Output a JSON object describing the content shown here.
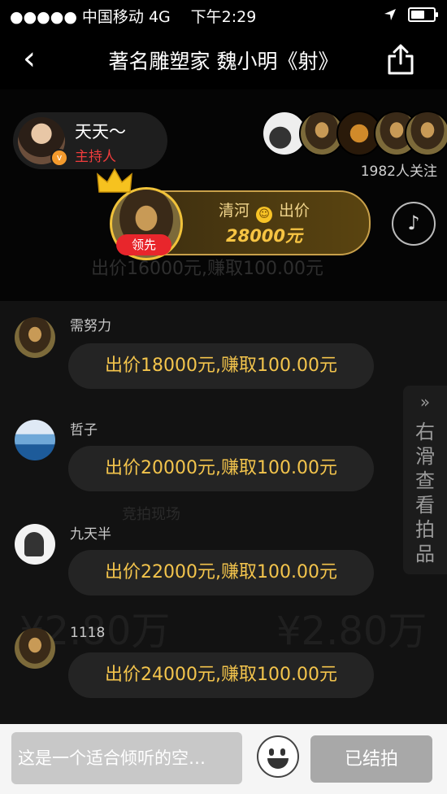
{
  "status_bar": {
    "carrier": "●●●●● 中国移动  4G",
    "time": "下午2:29"
  },
  "nav": {
    "back_glyph": "‹",
    "title": "著名雕塑家 魏小明《射》"
  },
  "host": {
    "name": "天天～",
    "role": "主持人",
    "badge": "v"
  },
  "followers": {
    "count_text": "1982人关注"
  },
  "top_bid": {
    "bidder": "清河",
    "emoji": "☺",
    "action": "出价",
    "amount": "28000元",
    "lead_tag": "领先"
  },
  "ghost_text": {
    "row": "出价16000元,赚取100.00元",
    "price_left": "¥2.80万",
    "price_right": "¥2.80万",
    "mid": "竞拍现场"
  },
  "messages": [
    {
      "name": "需努力",
      "text": "出价18000元,赚取100.00元"
    },
    {
      "name": "哲子",
      "text": "出价20000元,赚取100.00元"
    },
    {
      "name": "九天半",
      "text": "出价22000元,赚取100.00元"
    },
    {
      "name": "1118",
      "text": "出价24000元,赚取100.00元"
    }
  ],
  "side_tab": {
    "chevron": "»",
    "label": "右滑查看拍品"
  },
  "bottom": {
    "input_placeholder": "这是一个适合倾听的空…",
    "end_button": "已结拍"
  },
  "icons": [
    "back-icon",
    "share-icon",
    "location-icon",
    "battery-icon",
    "crown-icon",
    "music-icon",
    "emoji-icon",
    "chevron-right-icon"
  ],
  "colors": {
    "accent_gold": "#f3c44c",
    "host_red": "#f03c3c",
    "lead_red": "#e8262c"
  }
}
